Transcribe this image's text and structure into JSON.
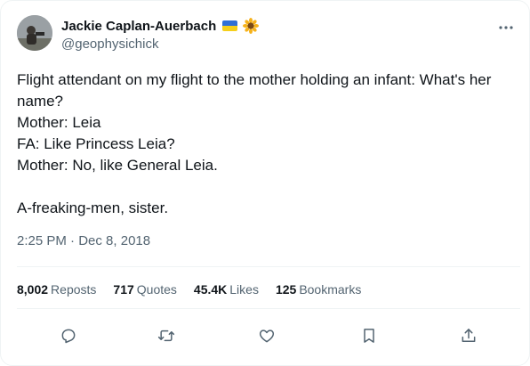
{
  "author": {
    "display_name": "Jackie Caplan-Auerbach",
    "handle": "@geophysichick",
    "avatar_icon": "profile-photo",
    "emoji_icons": [
      "ukraine-flag-icon",
      "sunflower-icon"
    ]
  },
  "tweet": {
    "lines": [
      "Flight attendant on my flight to the mother holding an infant: What's her",
      "name?",
      "Mother: Leia",
      "FA: Like Princess Leia?",
      "Mother: No, like General Leia.",
      "",
      "A-freaking-men, sister."
    ],
    "time": "2:25 PM",
    "separator": "·",
    "date": "Dec 8, 2018"
  },
  "stats": {
    "reposts": {
      "count": "8,002",
      "label": "Reposts"
    },
    "quotes": {
      "count": "717",
      "label": "Quotes"
    },
    "likes": {
      "count": "45.4K",
      "label": "Likes"
    },
    "bookmarks": {
      "count": "125",
      "label": "Bookmarks"
    }
  },
  "actions": [
    "reply-icon",
    "repost-icon",
    "like-icon",
    "bookmark-icon",
    "share-icon"
  ],
  "colors": {
    "text": "#0f1419",
    "secondary": "#536471",
    "border": "#eff3f4"
  }
}
